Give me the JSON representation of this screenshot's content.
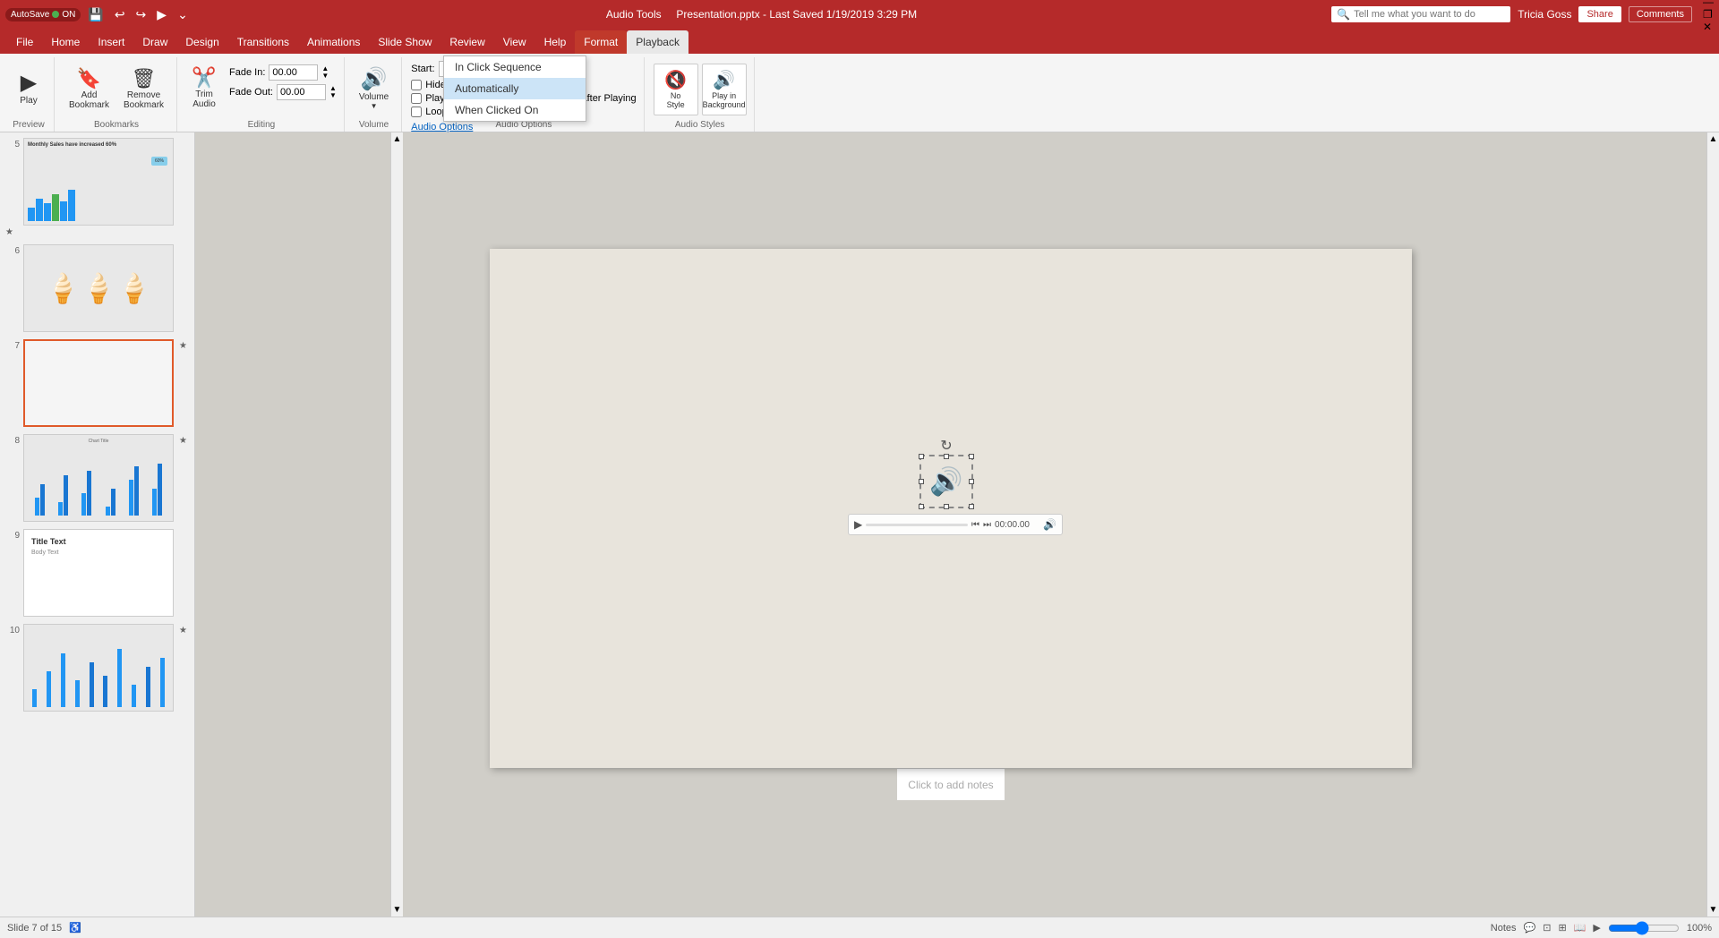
{
  "app": {
    "name": "AutoSave",
    "autosave_on": "ON",
    "title": "Presentation.pptx - Last Saved 1/19/2019 3:29 PM",
    "tab_label": "Audio Tools",
    "user": "Tricia Goss"
  },
  "qat": {
    "save_icon": "💾",
    "undo_icon": "↩",
    "redo_icon": "↪",
    "present_icon": "▶",
    "customize_icon": "⌄"
  },
  "ribbon_tabs": [
    {
      "label": "File",
      "active": false
    },
    {
      "label": "Home",
      "active": false
    },
    {
      "label": "Insert",
      "active": false
    },
    {
      "label": "Draw",
      "active": false
    },
    {
      "label": "Design",
      "active": false
    },
    {
      "label": "Transitions",
      "active": false
    },
    {
      "label": "Animations",
      "active": false
    },
    {
      "label": "Slide Show",
      "active": false
    },
    {
      "label": "Review",
      "active": false
    },
    {
      "label": "View",
      "active": false
    },
    {
      "label": "Help",
      "active": false
    },
    {
      "label": "Format",
      "active": true,
      "highlight": true
    },
    {
      "label": "Playback",
      "active": true
    }
  ],
  "ribbon": {
    "preview_group": {
      "label": "Preview",
      "play_btn": "▶",
      "play_label": "Play"
    },
    "bookmarks_group": {
      "label": "Bookmarks",
      "add_label": "Add\nBookmark",
      "remove_label": "Remove\nBookmark"
    },
    "editing_group": {
      "label": "Editing",
      "trim_label": "Trim\nAudio"
    },
    "fade_group": {
      "label": "Editing",
      "fade_in_label": "Fade In:",
      "fade_in_value": "00.00",
      "fade_out_label": "Fade Out:",
      "fade_out_value": "00.00"
    },
    "volume_group": {
      "label": "Volume",
      "icon": "🔊"
    },
    "audio_options_group": {
      "label": "Audio Options",
      "start_label": "Start:",
      "start_value": "In Click Sequence",
      "hide_during_show": "Hide During Show",
      "hide_checked": false,
      "play_across_slides": "Play Across Slides",
      "play_across_checked": false,
      "loop_until_stopped": "Loop Until Stopped",
      "loop_checked": false,
      "rewind_after_playing": "Rewind after Playing",
      "rewind_checked": false,
      "audio_options_link": "Audio Options"
    },
    "audio_styles_group": {
      "label": "Audio Styles",
      "no_style_label": "No\nStyle",
      "play_background_label": "Play in\nBackground"
    }
  },
  "dropdown": {
    "items": [
      {
        "label": "In Click Sequence",
        "active": false
      },
      {
        "label": "Automatically",
        "active": true
      },
      {
        "label": "When Clicked On",
        "active": false
      }
    ]
  },
  "slides": [
    {
      "num": "5",
      "star": "★",
      "type": "chart",
      "title": "Monthly Sales have increased 60%"
    },
    {
      "num": "6",
      "star": "",
      "type": "icecream"
    },
    {
      "num": "7",
      "star": "★",
      "type": "empty",
      "active": true
    },
    {
      "num": "8",
      "star": "★",
      "type": "barchart"
    },
    {
      "num": "9",
      "star": "",
      "type": "titletext",
      "title": "Title Text",
      "subtitle": "Body Text"
    },
    {
      "num": "10",
      "star": "★",
      "type": "barchart2"
    }
  ],
  "canvas": {
    "notes_placeholder": "Click to add notes"
  },
  "audio": {
    "time": "00:00.00",
    "play_icon": "▶",
    "rewind_icon": "⏮",
    "forward_icon": "⏭",
    "volume_icon": "🔊"
  },
  "statusbar": {
    "slide_info": "Slide 7 of 15",
    "notes_label": "Notes",
    "zoom_level": "100%",
    "accessibility_icon": "♿"
  },
  "search": {
    "placeholder": "Tell me what you want to do"
  },
  "share_btn": "Share",
  "comments_btn": "Comments",
  "win_controls": {
    "minimize": "—",
    "restore": "❐",
    "close": "✕"
  }
}
